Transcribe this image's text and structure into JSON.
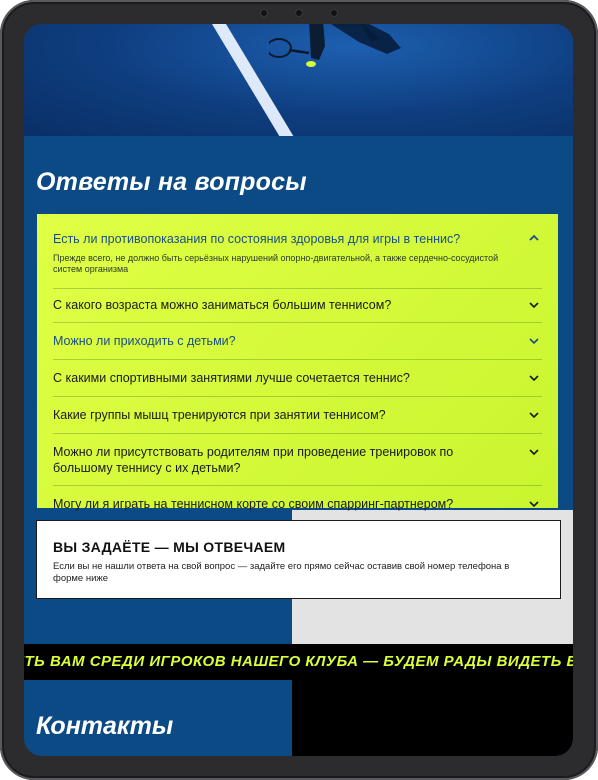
{
  "faq": {
    "title": "Ответы  на вопросы",
    "items": [
      {
        "question": "Есть ли противопоказания по состояния здоровья для игры в теннис?",
        "answer": "Прежде всего, не должно быть серьёзных нарушений опорно-двигательной, а также сердечно-сосудистой систем организма",
        "expanded": true,
        "highlighted": true
      },
      {
        "question": "С какого возраста можно заниматься большим теннисом?",
        "expanded": false,
        "highlighted": false
      },
      {
        "question": "Можно ли приходить с детьми?",
        "expanded": false,
        "highlighted": true
      },
      {
        "question": "С какими спортивными занятиями лучше сочетается теннис?",
        "expanded": false,
        "highlighted": false
      },
      {
        "question": "Какие группы мышц тренируются при занятии теннисом?",
        "expanded": false,
        "highlighted": false
      },
      {
        "question": "Можно ли присутствовать родителям при проведение тренировок по большому теннису с их детьми?",
        "expanded": false,
        "highlighted": false
      },
      {
        "question": "Могу ли я играть на теннисном корте со своим спарринг-партнером?",
        "expanded": false,
        "highlighted": false
      }
    ]
  },
  "ask": {
    "title": "ВЫ ЗАДАЁТЕ — МЫ ОТВЕЧАЕМ",
    "text": "Если вы не нашли ответа на свой вопрос — задайте его прямо сейчас оставив свой номер телефона в форме ниже"
  },
  "ticker": {
    "text": "ЕТЬ ВАМ СРЕДИ ИГРОКОВ НАШЕГО КЛУБА — БУДЕМ РАДЫ ВИДЕТЬ ВА"
  },
  "contacts": {
    "title": "Контакты"
  },
  "icons": {
    "expanded": "chevron-up-icon",
    "collapsed": "chevron-down-icon"
  },
  "colors": {
    "accent": "#d9ff3b",
    "brand_blue": "#0c4a86",
    "highlight_text": "#1a4e86"
  }
}
